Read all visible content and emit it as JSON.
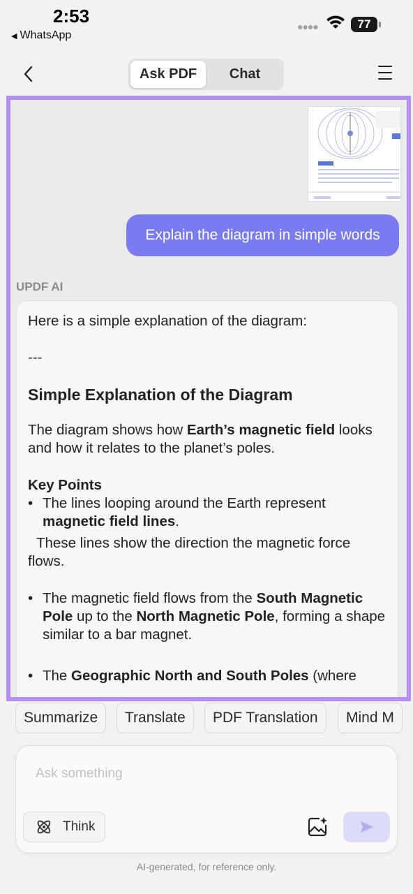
{
  "status_bar": {
    "time": "2:53",
    "back_app": "WhatsApp",
    "battery": "77"
  },
  "header": {
    "tabs": [
      {
        "label": "Ask PDF",
        "active": true
      },
      {
        "label": "Chat",
        "active": false
      }
    ]
  },
  "chat": {
    "user_message": "Explain the diagram in simple words",
    "ai_label": "UPDF AI",
    "ai_response": {
      "intro": "Here is a simple explanation of the diagram:",
      "separator": "---",
      "heading": "Simple Explanation of the Diagram",
      "para1_pre": "The diagram shows how ",
      "para1_bold": "Earth’s magnetic field",
      "para1_post": " looks and how it relates to the planet’s poles.",
      "key_points_heading": "Key Points",
      "bullet1_pre": "The lines looping around the Earth represent ",
      "bullet1_bold": "magnetic field lines",
      "bullet1_post": ".",
      "bullet1_cont": "These lines show the direction the magnetic force flows.",
      "bullet2_pre": "The magnetic field flows from the ",
      "bullet2_bold1": "South Magnetic Pole",
      "bullet2_mid": " up to the ",
      "bullet2_bold2": "North Magnetic Pole",
      "bullet2_post": ", forming a shape similar to a bar magnet.",
      "bullet3_pre": "The ",
      "bullet3_bold": "Geographic North and South Poles",
      "bullet3_post": " (where"
    }
  },
  "suggestions": [
    "Summarize",
    "Translate",
    "PDF Translation",
    "Mind M"
  ],
  "input": {
    "placeholder": "Ask something",
    "value": "",
    "think_label": "Think"
  },
  "disclaimer": "AI-generated, for reference only.",
  "colors": {
    "accent": "#7b7bf0",
    "frame_border": "#b48ef0",
    "send_disabled": "#dcdcf8"
  }
}
